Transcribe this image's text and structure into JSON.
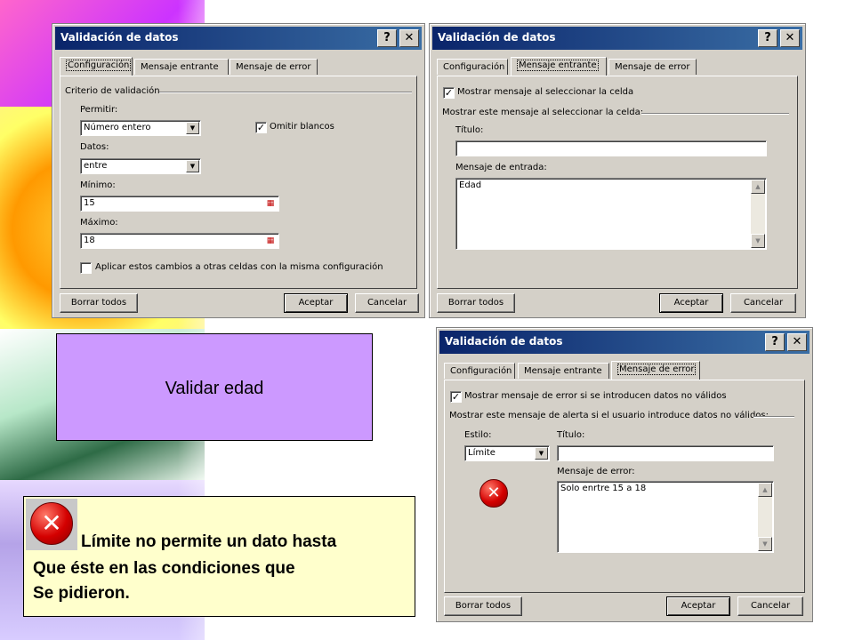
{
  "colors": {
    "titlebar_start": "#0a246a",
    "titlebar_end": "#3a6ea5",
    "dialog_bg": "#d4d0c8",
    "note_purple": "#cc99ff",
    "note_yellow": "#ffffcc",
    "error_red": "#d40000"
  },
  "dialog1": {
    "title": "Validación de datos",
    "help": "?",
    "close": "✕",
    "tabs": [
      "Configuración",
      "Mensaje entrante",
      "Mensaje de error"
    ],
    "active_tab": "Configuración",
    "group": "Criterio de validación",
    "permitir_label": "Permitir:",
    "permitir_value": "Número entero",
    "omitir_label": "Omitir blancos",
    "omitir_checked": true,
    "datos_label": "Datos:",
    "datos_value": "entre",
    "minimo_label": "Mínimo:",
    "minimo_value": "15",
    "maximo_label": "Máximo:",
    "maximo_value": "18",
    "aplicar_label": "Aplicar estos cambios a otras celdas con la misma configuración",
    "aplicar_checked": false,
    "btn_clear": "Borrar todos",
    "btn_ok": "Aceptar",
    "btn_cancel": "Cancelar"
  },
  "dialog2": {
    "title": "Validación de datos",
    "help": "?",
    "close": "✕",
    "tabs": [
      "Configuración",
      "Mensaje entrante",
      "Mensaje de error"
    ],
    "active_tab": "Mensaje entrante",
    "show_label": "Mostrar mensaje al seleccionar la celda",
    "show_checked": true,
    "group": "Mostrar este mensaje al seleccionar la celda:",
    "titulo_label": "Título:",
    "titulo_value": "",
    "mensaje_label": "Mensaje de entrada:",
    "mensaje_value": "Edad",
    "btn_clear": "Borrar todos",
    "btn_ok": "Aceptar",
    "btn_cancel": "Cancelar"
  },
  "dialog3": {
    "title": "Validación de datos",
    "help": "?",
    "close": "✕",
    "tabs": [
      "Configuración",
      "Mensaje entrante",
      "Mensaje de error"
    ],
    "active_tab": "Mensaje de error",
    "show_label": "Mostrar mensaje de error si se introducen datos no válidos",
    "show_checked": true,
    "group": "Mostrar este mensaje de alerta si el usuario introduce datos no válidos:",
    "estilo_label": "Estilo:",
    "estilo_value": "Límite",
    "titulo_label": "Título:",
    "titulo_value": "",
    "mensaje_label": "Mensaje de error:",
    "mensaje_value": "Solo enrtre 15 a 18",
    "icon": "error-icon",
    "btn_clear": "Borrar todos",
    "btn_ok": "Aceptar",
    "btn_cancel": "Cancelar"
  },
  "note_purple": {
    "text": "Validar edad"
  },
  "note_yellow": {
    "line1": "Límite no permite un dato hasta",
    "line2": "Que éste en las condiciones que",
    "line3": "Se pidieron.",
    "icon": "error-icon"
  }
}
